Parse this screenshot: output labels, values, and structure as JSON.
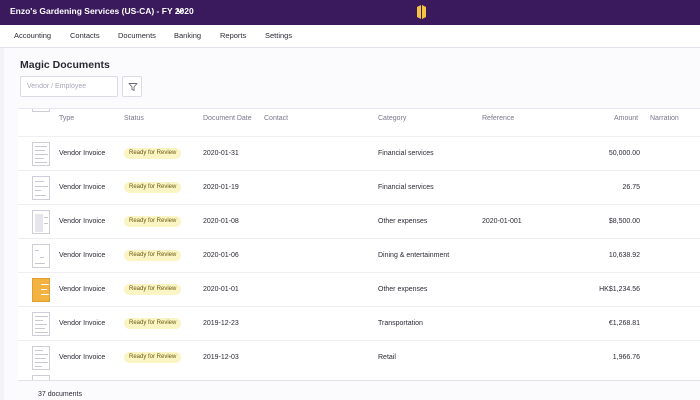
{
  "header": {
    "org_title": "Enzo's Gardening Services (US-CA) - FY 2020",
    "org_chevron_icon": "chevron-down-icon",
    "logo_icon": "app-logo-icon",
    "colors": {
      "header_bg": "#3a1a5c",
      "logo": "#f3c342",
      "badge_bg": "#fbf4c4"
    }
  },
  "nav": {
    "items": [
      "Accounting",
      "Contacts",
      "Documents",
      "Banking",
      "Reports",
      "Settings"
    ]
  },
  "page": {
    "title": "Magic Documents",
    "search_placeholder": "Vendor / Employee",
    "filter_icon": "filter-icon"
  },
  "table": {
    "columns": [
      "Type",
      "Status",
      "Document Date",
      "Contact",
      "Category",
      "Reference",
      "Amount",
      "Narration"
    ],
    "rows": [
      {
        "type": "Vendor Invoice",
        "status": "Ready for Review",
        "date": "2020-01-31",
        "contact": "",
        "category": "Financial services",
        "reference": "",
        "amount": "50,000.00",
        "narration": ""
      },
      {
        "type": "Vendor Invoice",
        "status": "Ready for Review",
        "date": "2020-01-19",
        "contact": "",
        "category": "Financial services",
        "reference": "",
        "amount": "26.75",
        "narration": ""
      },
      {
        "type": "Vendor Invoice",
        "status": "Ready for Review",
        "date": "2020-01-08",
        "contact": "",
        "category": "Other expenses",
        "reference": "2020-01-001",
        "amount": "$8,500.00",
        "narration": ""
      },
      {
        "type": "Vendor Invoice",
        "status": "Ready for Review",
        "date": "2020-01-06",
        "contact": "",
        "category": "Dining & entertainment",
        "reference": "",
        "amount": "10,638.92",
        "narration": ""
      },
      {
        "type": "Vendor Invoice",
        "status": "Ready for Review",
        "date": "2020-01-01",
        "contact": "",
        "category": "Other expenses",
        "reference": "",
        "amount": "HK$1,234.56",
        "narration": ""
      },
      {
        "type": "Vendor Invoice",
        "status": "Ready for Review",
        "date": "2019-12-23",
        "contact": "",
        "category": "Transportation",
        "reference": "",
        "amount": "€1,268.81",
        "narration": ""
      },
      {
        "type": "Vendor Invoice",
        "status": "Ready for Review",
        "date": "2019-12-03",
        "contact": "",
        "category": "Retail",
        "reference": "",
        "amount": "1,966.76",
        "narration": ""
      }
    ]
  },
  "footer": {
    "doc_count": "37 documents"
  }
}
